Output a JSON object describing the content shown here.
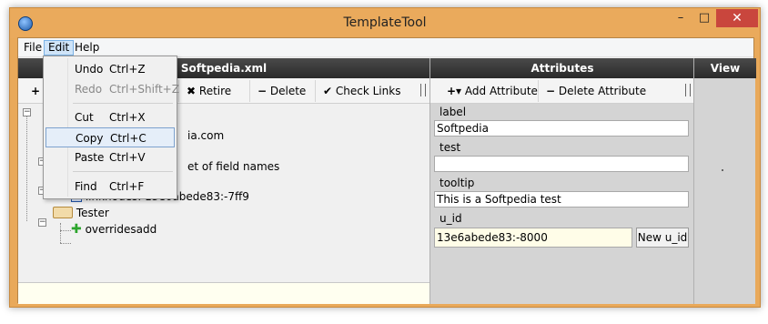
{
  "window": {
    "title": "TemplateTool",
    "minimize": "–",
    "maximize": "□",
    "close": "✕"
  },
  "menubar": {
    "file": "File",
    "edit": "Edit",
    "help": "Help"
  },
  "edit_menu": {
    "items": [
      {
        "label": "Undo",
        "shortcut": "Ctrl+Z"
      },
      {
        "label": "Redo",
        "shortcut": "Ctrl+Shift+Z"
      },
      {
        "label": "Cut",
        "shortcut": "Ctrl+X"
      },
      {
        "label": "Copy",
        "shortcut": "Ctrl+C"
      },
      {
        "label": "Paste",
        "shortcut": "Ctrl+V"
      },
      {
        "label": "Find",
        "shortcut": "Ctrl+F"
      }
    ]
  },
  "tree_pane": {
    "header": "Softpedia.xml",
    "toolbar": {
      "add": "+",
      "retire": "Retire",
      "delete": "Delete",
      "check_links": "Check Links"
    },
    "nodes": [
      {
        "text": "ia.com"
      },
      {
        "text": "et of field names"
      },
      {
        "text": "linknodes: 13e6abede83:-7ff9"
      },
      {
        "text": "Tester"
      },
      {
        "text": "overridesadd"
      }
    ]
  },
  "attributes_pane": {
    "header": "Attributes",
    "toolbar": {
      "add_attribute": "Add Attribute",
      "delete_attribute": "Delete Attribute"
    },
    "fields": [
      {
        "label": "label",
        "value": "Softpedia"
      },
      {
        "label": "test",
        "value": ""
      },
      {
        "label": "tooltip",
        "value": "This is a Softpedia test"
      },
      {
        "label": "u_id",
        "value": "13e6abede83:-8000"
      }
    ],
    "new_uid_button": "New u_id"
  },
  "view_pane": {
    "header": "View"
  },
  "icons": {
    "app": "globe-icon",
    "retire": "x-cross-icon",
    "delete": "minus-icon",
    "check_links": "checkmark-icon",
    "add_attribute": "plus-dropdown-icon",
    "tester": "book-icon",
    "overridesadd": "green-plus-icon"
  }
}
